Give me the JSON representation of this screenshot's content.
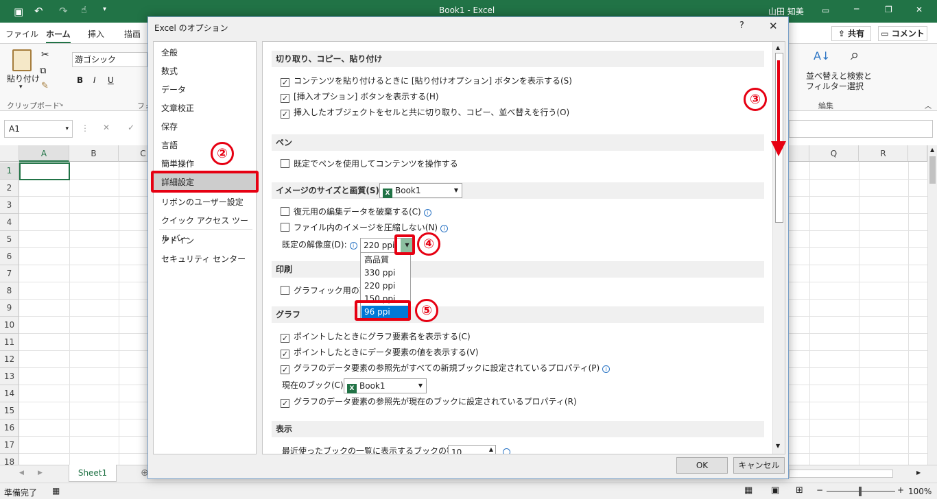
{
  "excel": {
    "title": "Book1  -  Excel",
    "user": "山田 知美",
    "tabs": [
      "ファイル",
      "ホーム",
      "挿入",
      "描画"
    ],
    "share": "共有",
    "comment": "コメント",
    "paste": "貼り付け",
    "clipboard": "クリップボード",
    "font_name": "游ゴシック",
    "font_group_partial": "フォ",
    "sort_filter": "並べ替えと\nフィルター",
    "find_select": "検索と\n選択",
    "editing": "編集",
    "name_box": "A1",
    "columns": [
      "A",
      "B",
      "C",
      "Q",
      "R"
    ],
    "rows": [
      "1",
      "2",
      "3",
      "4",
      "5",
      "6",
      "7",
      "8",
      "9",
      "10",
      "11",
      "12",
      "13",
      "14",
      "15",
      "16",
      "17",
      "18"
    ],
    "sheet_tab": "Sheet1",
    "status": "準備完了",
    "zoom": "100%"
  },
  "dialog": {
    "title": "Excel のオプション",
    "help": "?",
    "close": "✕",
    "nav": [
      "全般",
      "数式",
      "データ",
      "文章校正",
      "保存",
      "言語",
      "簡単操作",
      "詳細設定",
      "リボンのユーザー設定",
      "クイック アクセス ツール バー",
      "アドイン",
      "セキュリティ センター"
    ],
    "sections": {
      "cut": {
        "title": "切り取り、コピー、貼り付け",
        "opts": [
          "コンテンツを貼り付けるときに [貼り付けオプション] ボタンを表示する(S)",
          "[挿入オプション] ボタンを表示する(H)",
          "挿入したオブジェクトをセルと共に切り取り、コピー、並べ替えを行う(O)"
        ]
      },
      "pen": {
        "title": "ペン",
        "opts": [
          "既定でペンを使用してコンテンツを操作する"
        ]
      },
      "image": {
        "title": "イメージのサイズと画質(S)",
        "book": "Book1",
        "opts": [
          "復元用の編集データを破棄する(C)",
          "ファイル内のイメージを圧縮しない(N)"
        ],
        "resolution_label": "既定の解像度(D):",
        "resolution_value": "220 ppi",
        "dropdown": [
          "高品質",
          "330 ppi",
          "220 ppi",
          "150 ppi",
          "96 ppi"
        ]
      },
      "print": {
        "title": "印刷",
        "opts": [
          "グラフィック用の高画質"
        ]
      },
      "graph": {
        "title": "グラフ",
        "opts": [
          "ポイントしたときにグラフ要素名を表示する(C)",
          "ポイントしたときにデータ要素の値を表示する(V)",
          "グラフのデータ要素の参照先がすべての新規ブックに設定されているプロパティ(P)"
        ],
        "current_book_label": "現在のブック(C):",
        "current_book": "Book1",
        "opt_last": "グラフのデータ要素の参照先が現在のブックに設定されているプロパティ(R)"
      },
      "display": {
        "title": "表示",
        "recent_label": "最近使ったブックの一覧に表示するブックの数(R):",
        "recent_value": "10"
      }
    },
    "ok": "OK",
    "cancel": "キャンセル"
  },
  "annotations": [
    "②",
    "③",
    "④",
    "⑤"
  ],
  "colors": {
    "excel_green": "#217346",
    "highlight_red": "#e60012",
    "selection_blue": "#0078d7"
  }
}
